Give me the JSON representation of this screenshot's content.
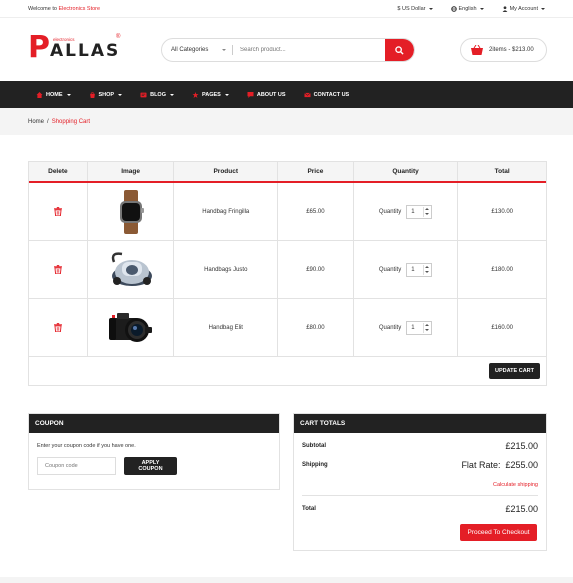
{
  "topbar": {
    "welcome_prefix": "Welcome to ",
    "welcome_store": "Electronics Store",
    "currency": "$ US Dollar",
    "language": "English",
    "account": "My Account"
  },
  "logo": {
    "letter": "P",
    "rest": "ALLAS",
    "sub": "electronics",
    "reg": "®"
  },
  "search": {
    "category": "All Categories",
    "placeholder": "Search product..."
  },
  "mini_cart": {
    "summary": "2items - $213.00"
  },
  "nav": [
    {
      "label": "HOME",
      "has_caret": true
    },
    {
      "label": "SHOP",
      "has_caret": true
    },
    {
      "label": "BLOG",
      "has_caret": true
    },
    {
      "label": "PAGES",
      "has_caret": true
    },
    {
      "label": "ABOUT US",
      "has_caret": false
    },
    {
      "label": "CONTACT US",
      "has_caret": false
    }
  ],
  "breadcrumb": {
    "home": "Home",
    "separator": "/",
    "current": "Shopping Cart"
  },
  "cart_table": {
    "headers": [
      "Delete",
      "Image",
      "Product",
      "Price",
      "Quantity",
      "Total"
    ],
    "quantity_label": "Quantity",
    "rows": [
      {
        "image": "smartwatch",
        "product": "Handbag Fringilla",
        "price": "£65.00",
        "qty": "1",
        "total": "£130.00"
      },
      {
        "image": "robot-vacuum",
        "product": "Handbags Justo",
        "price": "£90.00",
        "qty": "1",
        "total": "£180.00"
      },
      {
        "image": "dslr-camera",
        "product": "Handbag Elit",
        "price": "£80.00",
        "qty": "1",
        "total": "£160.00"
      }
    ],
    "update_button": "UPDATE CART"
  },
  "coupon": {
    "title": "COUPON",
    "hint": "Enter your coupon code if you have one.",
    "placeholder": "Coupon code",
    "button": "APPLY COUPON"
  },
  "totals": {
    "title": "CART TOTALS",
    "subtotal_label": "Subtotal",
    "subtotal_value": "£215.00",
    "shipping_label": "Shipping",
    "shipping_value": "Flat Rate:  £255.00",
    "calc_shipping": "Calculate shipping",
    "total_label": "Total",
    "total_value": "£215.00",
    "checkout_button": "Proceed To Checkout"
  },
  "colors": {
    "accent": "#e41e26",
    "dark": "#222222"
  }
}
